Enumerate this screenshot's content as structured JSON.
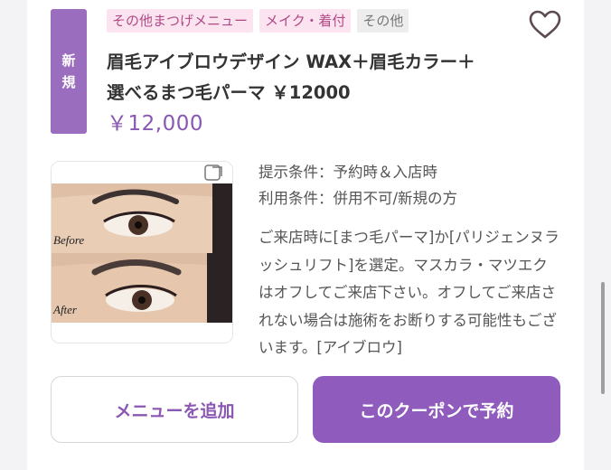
{
  "badge": {
    "new_line1": "新",
    "new_line2": "規"
  },
  "tags": [
    "その他まつげメニュー",
    "メイク・着付",
    "その他"
  ],
  "coupon": {
    "title_line1": "眉毛アイブロウデザイン WAX＋眉毛カラー＋",
    "title_line2": "選べるまつ毛パーマ ￥12000",
    "price": "￥12,000"
  },
  "photo": {
    "before_label": "Before",
    "after_label": "After"
  },
  "conditions": {
    "present": "提示条件：予約時＆入店時",
    "use": "利用条件：併用不可/新規の方"
  },
  "description": "ご来店時に[まつ毛パーマ]か[パリジェンヌラッシュリフト]を選定。マスカラ・マツエクはオフしてご来店下さい。オフしてご来店されない場合は施術をお断りする可能性もございます。[アイブロウ]",
  "buttons": {
    "add_menu": "メニューを追加",
    "reserve": "このクーポンで予約"
  },
  "icons": {
    "favorite": "heart-outline-icon"
  },
  "colors": {
    "accent": "#8f5bbd",
    "tag_pink_bg": "#fbe4f0",
    "price": "#8a57b3"
  }
}
